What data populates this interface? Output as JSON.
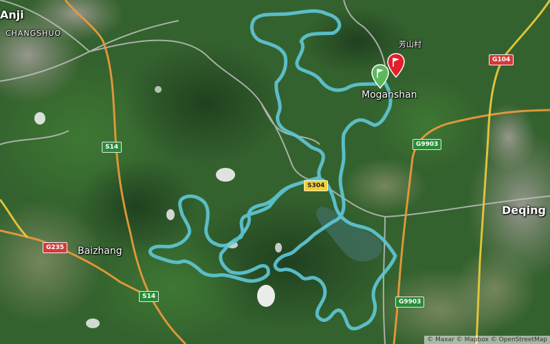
{
  "labels": {
    "anji": "Anji",
    "changshuo": "CHANGSHUO",
    "fangshancun": "芳山村",
    "moganshan": "Moganshan",
    "deqing": "Deqing",
    "baizhang": "Baizhang"
  },
  "road_shields": {
    "s14_north": "S14",
    "s14_south": "S14",
    "g235": "G235",
    "s304": "S304",
    "g9903_north": "G9903",
    "g9903_south": "G9903",
    "g104": "G104"
  },
  "markers": {
    "start": {
      "type": "start-flag",
      "color": "#5cb85c"
    },
    "end": {
      "type": "end-flag",
      "color": "#e0202a"
    }
  },
  "route": {
    "color": "#5fc8d8"
  },
  "attribution": "© Maxar © Mapbox © OpenStreetMap"
}
